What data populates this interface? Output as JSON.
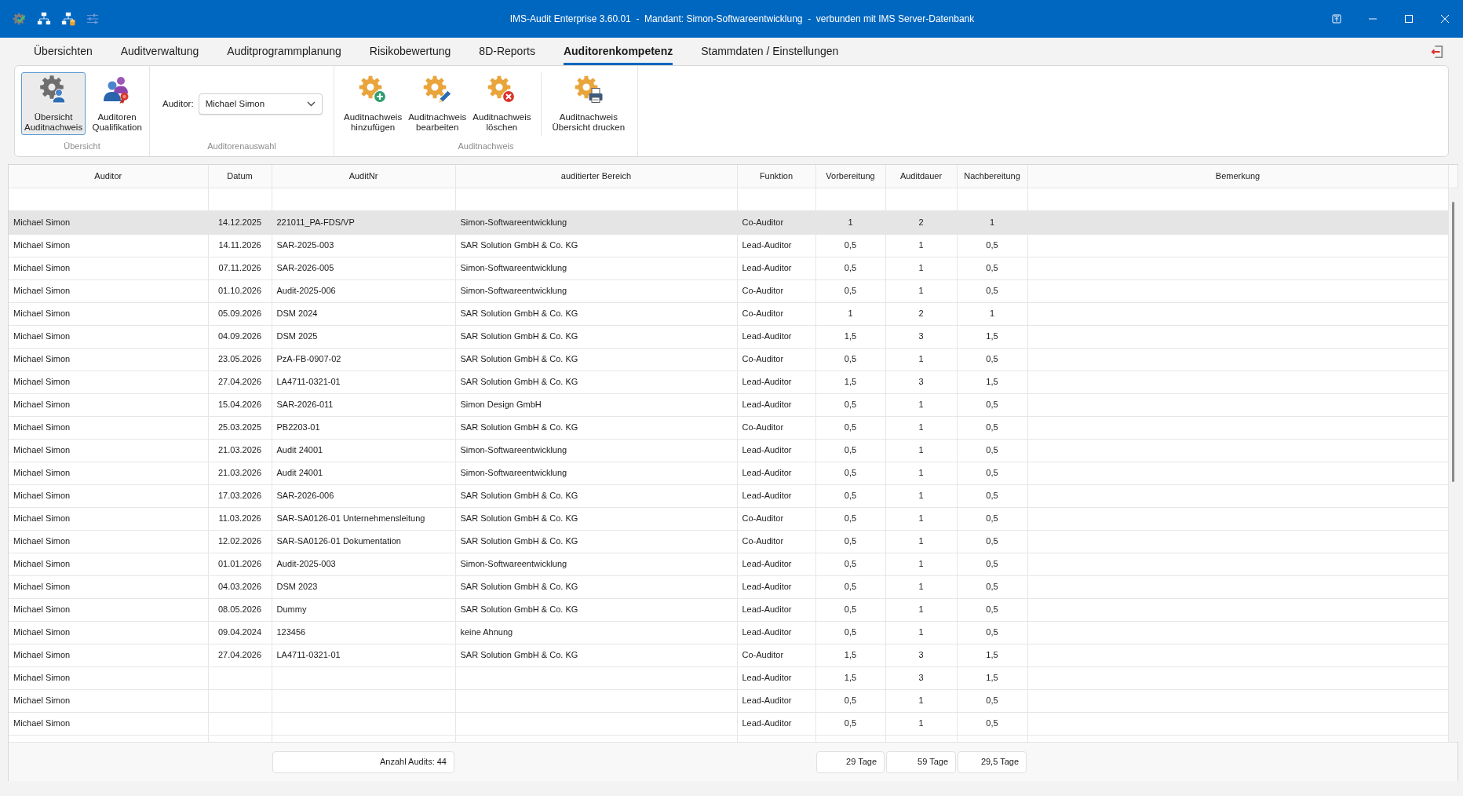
{
  "window": {
    "title": "IMS-Audit Enterprise 3.60.01  -  Mandant: Simon-Softwareentwicklung  -  verbunden mit IMS Server-Datenbank"
  },
  "menu_tabs": [
    {
      "label": "Übersichten",
      "selected": false
    },
    {
      "label": "Auditverwaltung",
      "selected": false
    },
    {
      "label": "Auditprogrammplanung",
      "selected": false
    },
    {
      "label": "Risikobewertung",
      "selected": false
    },
    {
      "label": "8D-Reports",
      "selected": false
    },
    {
      "label": "Auditorenkompetenz",
      "selected": true
    },
    {
      "label": "Stammdaten / Einstellungen",
      "selected": false
    }
  ],
  "ribbon": {
    "groups": [
      {
        "label": "Übersicht",
        "sections": [
          [
            {
              "kind": "overview",
              "lines": [
                "Übersicht",
                "Auditnachweis"
              ],
              "selected": true
            },
            {
              "kind": "qualification",
              "lines": [
                "Auditoren",
                "Qualifikation"
              ],
              "selected": false
            }
          ]
        ]
      },
      {
        "label": "Auditorenauswahl",
        "field": {
          "label": "Auditor:",
          "value": "Michael Simon"
        }
      },
      {
        "label": "Auditnachweis",
        "sections": [
          [
            {
              "kind": "add",
              "lines": [
                "Auditnachweis",
                "hinzufügen"
              ]
            },
            {
              "kind": "edit",
              "lines": [
                "Auditnachweis",
                "bearbeiten"
              ]
            },
            {
              "kind": "delete",
              "lines": [
                "Auditnachweis",
                "löschen"
              ]
            }
          ],
          [
            {
              "kind": "print",
              "lines": [
                "Auditnachweis",
                "Übersicht drucken"
              ]
            }
          ]
        ]
      }
    ]
  },
  "table": {
    "columns": [
      "Auditor",
      "Datum",
      "AuditNr",
      "auditierter Bereich",
      "Funktion",
      "Vorbereitung",
      "Auditdauer",
      "Nachbereitung",
      "Bemerkung"
    ],
    "rows": [
      {
        "auditor": "Michael Simon",
        "datum": "14.12.2025",
        "audit_nr": "221011_PA-FDS/VP",
        "auditierter_bereich": "Simon-Softwareentwicklung",
        "funktion": "Co-Auditor",
        "vorbereitung": "1",
        "auditdauer": "2",
        "nachbereitung": "1",
        "selected": true
      },
      {
        "auditor": "Michael Simon",
        "datum": "14.11.2026",
        "audit_nr": "SAR-2025-003",
        "auditierter_bereich": "SAR Solution GmbH & Co. KG",
        "funktion": "Lead-Auditor",
        "vorbereitung": "0,5",
        "auditdauer": "1",
        "nachbereitung": "0,5",
        "selected": false
      },
      {
        "auditor": "Michael Simon",
        "datum": "07.11.2026",
        "audit_nr": "SAR-2026-005",
        "auditierter_bereich": "Simon-Softwareentwicklung",
        "funktion": "Lead-Auditor",
        "vorbereitung": "0,5",
        "auditdauer": "1",
        "nachbereitung": "0,5",
        "selected": false
      },
      {
        "auditor": "Michael Simon",
        "datum": "01.10.2026",
        "audit_nr": "Audit-2025-006",
        "auditierter_bereich": "Simon-Softwareentwicklung",
        "funktion": "Co-Auditor",
        "vorbereitung": "0,5",
        "auditdauer": "1",
        "nachbereitung": "0,5",
        "selected": false
      },
      {
        "auditor": "Michael Simon",
        "datum": "05.09.2026",
        "audit_nr": "DSM 2024",
        "auditierter_bereich": "SAR Solution GmbH & Co. KG",
        "funktion": "Co-Auditor",
        "vorbereitung": "1",
        "auditdauer": "2",
        "nachbereitung": "1",
        "selected": false
      },
      {
        "auditor": "Michael Simon",
        "datum": "04.09.2026",
        "audit_nr": "DSM 2025",
        "auditierter_bereich": "SAR Solution GmbH & Co. KG",
        "funktion": "Lead-Auditor",
        "vorbereitung": "1,5",
        "auditdauer": "3",
        "nachbereitung": "1,5",
        "selected": false
      },
      {
        "auditor": "Michael Simon",
        "datum": "23.05.2026",
        "audit_nr": "PzA-FB-0907-02",
        "auditierter_bereich": "SAR Solution GmbH & Co. KG",
        "funktion": "Co-Auditor",
        "vorbereitung": "0,5",
        "auditdauer": "1",
        "nachbereitung": "0,5",
        "selected": false
      },
      {
        "auditor": "Michael Simon",
        "datum": "27.04.2026",
        "audit_nr": "LA4711-0321-01",
        "auditierter_bereich": "SAR Solution GmbH & Co. KG",
        "funktion": "Lead-Auditor",
        "vorbereitung": "1,5",
        "auditdauer": "3",
        "nachbereitung": "1,5",
        "selected": false
      },
      {
        "auditor": "Michael Simon",
        "datum": "15.04.2026",
        "audit_nr": "SAR-2026-011",
        "auditierter_bereich": "Simon Design GmbH",
        "funktion": "Lead-Auditor",
        "vorbereitung": "0,5",
        "auditdauer": "1",
        "nachbereitung": "0,5",
        "selected": false
      },
      {
        "auditor": "Michael Simon",
        "datum": "25.03.2025",
        "audit_nr": "PB2203-01",
        "auditierter_bereich": "SAR Solution GmbH & Co. KG",
        "funktion": "Co-Auditor",
        "vorbereitung": "0,5",
        "auditdauer": "1",
        "nachbereitung": "0,5",
        "selected": false
      },
      {
        "auditor": "Michael Simon",
        "datum": "21.03.2026",
        "audit_nr": "Audit 24001",
        "auditierter_bereich": "Simon-Softwareentwicklung",
        "funktion": "Lead-Auditor",
        "vorbereitung": "0,5",
        "auditdauer": "1",
        "nachbereitung": "0,5",
        "selected": false
      },
      {
        "auditor": "Michael Simon",
        "datum": "21.03.2026",
        "audit_nr": "Audit 24001",
        "auditierter_bereich": "Simon-Softwareentwicklung",
        "funktion": "Lead-Auditor",
        "vorbereitung": "0,5",
        "auditdauer": "1",
        "nachbereitung": "0,5",
        "selected": false
      },
      {
        "auditor": "Michael Simon",
        "datum": "17.03.2026",
        "audit_nr": "SAR-2026-006",
        "auditierter_bereich": "SAR Solution GmbH & Co. KG",
        "funktion": "Lead-Auditor",
        "vorbereitung": "0,5",
        "auditdauer": "1",
        "nachbereitung": "0,5",
        "selected": false
      },
      {
        "auditor": "Michael Simon",
        "datum": "11.03.2026",
        "audit_nr": "SAR-SA0126-01 Unternehmensleitung",
        "auditierter_bereich": "SAR Solution GmbH & Co. KG",
        "funktion": "Co-Auditor",
        "vorbereitung": "0,5",
        "auditdauer": "1",
        "nachbereitung": "0,5",
        "selected": false
      },
      {
        "auditor": "Michael Simon",
        "datum": "12.02.2026",
        "audit_nr": "SAR-SA0126-01 Dokumentation",
        "auditierter_bereich": "SAR Solution GmbH & Co. KG",
        "funktion": "Co-Auditor",
        "vorbereitung": "0,5",
        "auditdauer": "1",
        "nachbereitung": "0,5",
        "selected": false
      },
      {
        "auditor": "Michael Simon",
        "datum": "01.01.2026",
        "audit_nr": "Audit-2025-003",
        "auditierter_bereich": "Simon-Softwareentwicklung",
        "funktion": "Lead-Auditor",
        "vorbereitung": "0,5",
        "auditdauer": "1",
        "nachbereitung": "0,5",
        "selected": false
      },
      {
        "auditor": "Michael Simon",
        "datum": "04.03.2026",
        "audit_nr": "DSM 2023",
        "auditierter_bereich": "SAR Solution GmbH & Co. KG",
        "funktion": "Lead-Auditor",
        "vorbereitung": "0,5",
        "auditdauer": "1",
        "nachbereitung": "0,5",
        "selected": false
      },
      {
        "auditor": "Michael Simon",
        "datum": "08.05.2026",
        "audit_nr": "Dummy",
        "auditierter_bereich": "SAR Solution GmbH & Co. KG",
        "funktion": "Lead-Auditor",
        "vorbereitung": "0,5",
        "auditdauer": "1",
        "nachbereitung": "0,5",
        "selected": false
      },
      {
        "auditor": "Michael Simon",
        "datum": "09.04.2024",
        "audit_nr": "123456",
        "auditierter_bereich": "keine Ahnung",
        "funktion": "Lead-Auditor",
        "vorbereitung": "0,5",
        "auditdauer": "1",
        "nachbereitung": "0,5",
        "selected": false
      },
      {
        "auditor": "Michael Simon",
        "datum": "27.04.2026",
        "audit_nr": "LA4711-0321-01",
        "auditierter_bereich": "SAR Solution GmbH & Co. KG",
        "funktion": "Co-Auditor",
        "vorbereitung": "1,5",
        "auditdauer": "3",
        "nachbereitung": "1,5",
        "selected": false
      },
      {
        "auditor": "Michael Simon",
        "funktion": "Lead-Auditor",
        "vorbereitung": "1,5",
        "auditdauer": "3",
        "nachbereitung": "1,5",
        "selected": false
      },
      {
        "auditor": "Michael Simon",
        "funktion": "Lead-Auditor",
        "vorbereitung": "0,5",
        "auditdauer": "1",
        "nachbereitung": "0,5",
        "selected": false
      },
      {
        "auditor": "Michael Simon",
        "funktion": "Lead-Auditor",
        "vorbereitung": "0,5",
        "auditdauer": "1",
        "nachbereitung": "0,5",
        "selected": false
      }
    ]
  },
  "footer": {
    "count": "Anzahl Audits: 44",
    "totals": [
      "29 Tage",
      "59 Tage",
      "29,5 Tage"
    ]
  }
}
